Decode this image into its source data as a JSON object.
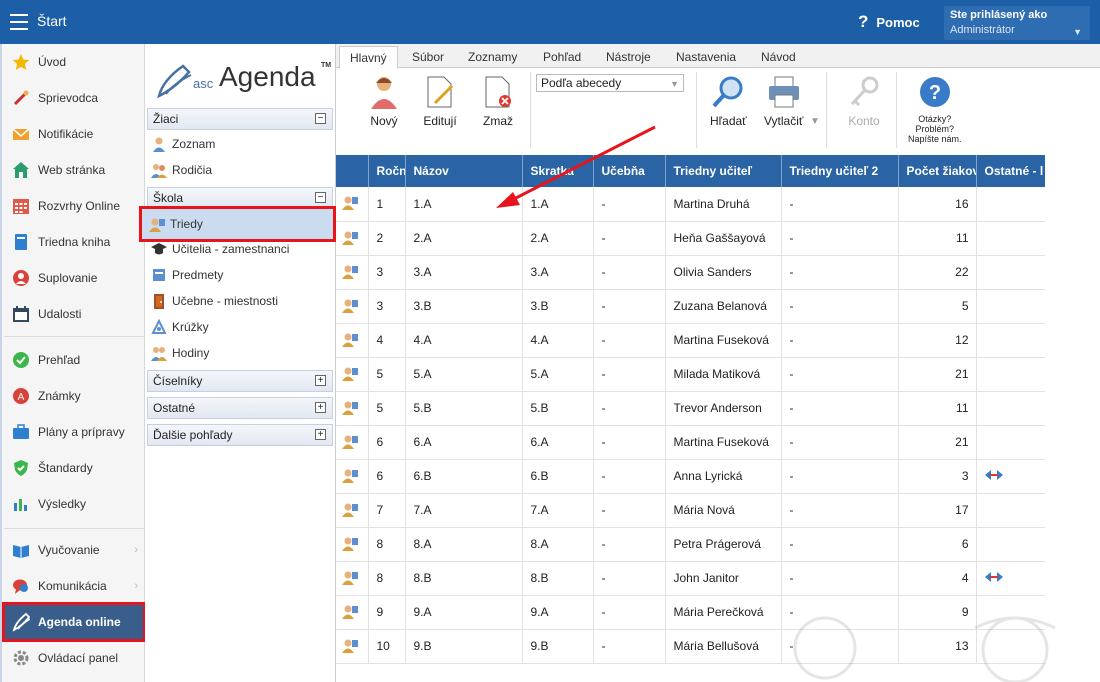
{
  "topbar": {
    "title": "Štart",
    "help_label": "Pomoc",
    "user_line1": "Ste prihlásený ako",
    "user_line2": "Administrátor"
  },
  "leftnav": {
    "items": [
      {
        "label": "Úvod"
      },
      {
        "label": "Sprievodca"
      },
      {
        "label": "Notifikácie"
      },
      {
        "label": "Web stránka"
      },
      {
        "label": "Rozvrhy Online"
      },
      {
        "label": "Triedna kniha"
      },
      {
        "label": "Suplovanie"
      },
      {
        "label": "Udalosti"
      },
      {
        "label": "Prehľad"
      },
      {
        "label": "Známky"
      },
      {
        "label": "Plány a prípravy"
      },
      {
        "label": "Štandardy"
      },
      {
        "label": "Výsledky"
      },
      {
        "label": "Vyučovanie"
      },
      {
        "label": "Komunikácia"
      },
      {
        "label": "Agenda online"
      },
      {
        "label": "Ovládací panel"
      }
    ]
  },
  "panel": {
    "logo_asc": "asc",
    "logo_name": "Agenda",
    "logo_tm": "TM",
    "sections": [
      "Žiaci",
      "Škola",
      "Číselníky",
      "Ostatné",
      "Ďalšie pohľady"
    ],
    "ziaci_items": [
      "Zoznam",
      "Rodičia"
    ],
    "skola_items": [
      "Triedy",
      "Učitelia - zamestnanci",
      "Predmety",
      "Učebne - miestnosti",
      "Krúžky",
      "Hodiny"
    ]
  },
  "ribbon": {
    "tabs": [
      "Hlavný",
      "Súbor",
      "Zoznamy",
      "Pohľad",
      "Nástroje",
      "Nastavenia",
      "Návod"
    ],
    "buttons": {
      "new": "Nový",
      "edit": "Editují",
      "delete": "Zmaž",
      "search": "Hľadať",
      "print": "Vytlačiť",
      "account": "Konto",
      "q1": "Otázky?",
      "q2": "Problém?",
      "q3": "Napíšte nám."
    },
    "sort_value": "Podľa abecedy"
  },
  "grid": {
    "headers": [
      "Ročn",
      "Názov",
      "Skratka",
      "Učebňa",
      "Triedny učiteľ",
      "Triedny učiteľ 2",
      "Počet žiakov",
      "Ostatné - l"
    ],
    "rows": [
      [
        "1",
        "1.A",
        "1.A",
        "-",
        "Martina Druhá",
        "-",
        "16",
        ""
      ],
      [
        "2",
        "2.A",
        "2.A",
        "-",
        "Heňa Gaššayová",
        "-",
        "11",
        ""
      ],
      [
        "3",
        "3.A",
        "3.A",
        "-",
        "Olivia Sanders",
        "-",
        "22",
        ""
      ],
      [
        "3",
        "3.B",
        "3.B",
        "-",
        "Zuzana Belanová",
        "-",
        "5",
        ""
      ],
      [
        "4",
        "4.A",
        "4.A",
        "-",
        "Martina Fuseková",
        "-",
        "12",
        ""
      ],
      [
        "5",
        "5.A",
        "5.A",
        "-",
        "Milada Matiková",
        "-",
        "21",
        ""
      ],
      [
        "5",
        "5.B",
        "5.B",
        "-",
        "Trevor Anderson",
        "-",
        "11",
        ""
      ],
      [
        "6",
        "6.A",
        "6.A",
        "-",
        "Martina Fuseková",
        "-",
        "21",
        ""
      ],
      [
        "6",
        "6.B",
        "6.B",
        "-",
        "Anna Lyrická",
        "-",
        "3",
        "link"
      ],
      [
        "7",
        "7.A",
        "7.A",
        "-",
        "Mária Nová",
        "-",
        "17",
        ""
      ],
      [
        "8",
        "8.A",
        "8.A",
        "-",
        "Petra Prágerová",
        "-",
        "6",
        ""
      ],
      [
        "8",
        "8.B",
        "8.B",
        "-",
        "John Janitor",
        "-",
        "4",
        "link"
      ],
      [
        "9",
        "9.A",
        "9.A",
        "-",
        "Mária Perečková",
        "-",
        "9",
        ""
      ],
      [
        "10",
        "9.B",
        "9.B",
        "-",
        "Mária Bellušová",
        "-",
        "13",
        ""
      ]
    ]
  },
  "colors": {
    "topbar": "#1d5fa7",
    "header": "#2a64a4",
    "highlight": "#e8141c"
  }
}
